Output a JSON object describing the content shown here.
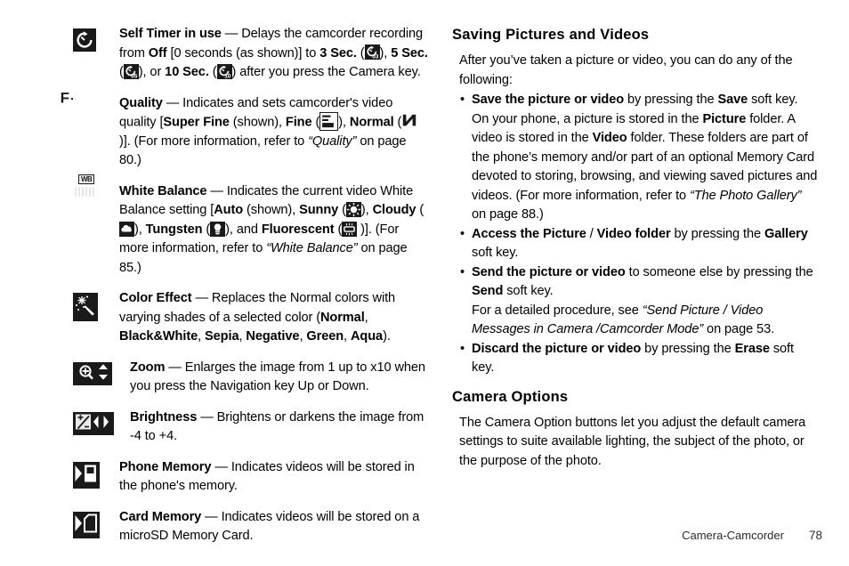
{
  "page": {
    "footer_chapter": "Camera-Camcorder",
    "footer_page_number": "78"
  },
  "left_column": {
    "items": [
      {
        "icon": "self-timer-icon",
        "term": "Self Timer in use",
        "text_parts": [
          {
            "t": " — Delays the camcorder recording from ",
            "style": "normal"
          },
          {
            "t": "Off",
            "style": "bold"
          },
          {
            "t": " [0 seconds (as shown)] to ",
            "style": "normal"
          },
          {
            "t": "3 Sec.",
            "style": "bold"
          },
          {
            "t": " (",
            "style": "normal"
          },
          {
            "t": "timer-03-icon",
            "style": "icon"
          },
          {
            "t": "), ",
            "style": "normal"
          },
          {
            "t": "5 Sec.",
            "style": "bold"
          },
          {
            "t": " (",
            "style": "normal"
          },
          {
            "t": "timer-05-icon",
            "style": "icon"
          },
          {
            "t": "), or ",
            "style": "normal"
          },
          {
            "t": "10 Sec.",
            "style": "bold"
          },
          {
            "t": " (",
            "style": "normal"
          },
          {
            "t": "timer-10-icon",
            "style": "icon"
          },
          {
            "t": ") after you press the Camera key.",
            "style": "normal"
          }
        ]
      },
      {
        "icon": "quality-super-fine-icon",
        "term": "Quality",
        "text_parts": [
          {
            "t": " — Indicates and sets camcorder's video quality [",
            "style": "normal"
          },
          {
            "t": "Super Fine",
            "style": "bold"
          },
          {
            "t": " (shown), ",
            "style": "normal"
          },
          {
            "t": "Fine",
            "style": "bold"
          },
          {
            "t": " (",
            "style": "normal"
          },
          {
            "t": "quality-fine-icon",
            "style": "icon"
          },
          {
            "t": "), ",
            "style": "normal"
          },
          {
            "t": "Normal",
            "style": "bold"
          },
          {
            "t": " (",
            "style": "normal"
          },
          {
            "t": "quality-normal-icon",
            "style": "icon"
          },
          {
            "t": " )]. (For more information, refer to ",
            "style": "normal"
          },
          {
            "t": "“Quality”",
            "style": "italic"
          },
          {
            "t": " on page 80.)",
            "style": "normal"
          }
        ]
      },
      {
        "icon": "white-balance-icon",
        "term": "White Balance",
        "text_parts": [
          {
            "t": " — Indicates the current video White Balance setting [",
            "style": "normal"
          },
          {
            "t": "Auto",
            "style": "bold"
          },
          {
            "t": " (shown), ",
            "style": "normal"
          },
          {
            "t": "Sunny",
            "style": "bold"
          },
          {
            "t": " (",
            "style": "normal"
          },
          {
            "t": "sunny-icon",
            "style": "icon"
          },
          {
            "t": "), ",
            "style": "normal"
          },
          {
            "t": "Cloudy",
            "style": "bold"
          },
          {
            "t": " (",
            "style": "normal"
          },
          {
            "t": "cloudy-icon",
            "style": "icon"
          },
          {
            "t": "), ",
            "style": "normal"
          },
          {
            "t": "Tungsten",
            "style": "bold"
          },
          {
            "t": " (",
            "style": "normal"
          },
          {
            "t": "tungsten-icon",
            "style": "icon"
          },
          {
            "t": "), and ",
            "style": "normal"
          },
          {
            "t": "Fluorescent",
            "style": "bold"
          },
          {
            "t": " (",
            "style": "normal"
          },
          {
            "t": "fluorescent-icon",
            "style": "icon"
          },
          {
            "t": " )]. (For more information, refer to ",
            "style": "normal"
          },
          {
            "t": "“White Balance”",
            "style": "italic"
          },
          {
            "t": " on page 85.)",
            "style": "normal"
          }
        ]
      },
      {
        "icon": "color-effect-icon",
        "term": "Color Effect",
        "text_parts": [
          {
            "t": " — Replaces the Normal colors with varying shades of a selected color (",
            "style": "normal"
          },
          {
            "t": "Normal",
            "style": "bold"
          },
          {
            "t": ", ",
            "style": "normal"
          },
          {
            "t": "Black&White",
            "style": "bold"
          },
          {
            "t": ", ",
            "style": "normal"
          },
          {
            "t": "Sepia",
            "style": "bold"
          },
          {
            "t": ", ",
            "style": "normal"
          },
          {
            "t": "Negative",
            "style": "bold"
          },
          {
            "t": ", ",
            "style": "normal"
          },
          {
            "t": "Green",
            "style": "bold"
          },
          {
            "t": ", ",
            "style": "normal"
          },
          {
            "t": "Aqua",
            "style": "bold"
          },
          {
            "t": ").",
            "style": "normal"
          }
        ]
      },
      {
        "icon": "zoom-icon",
        "term": "Zoom",
        "indent": true,
        "text_parts": [
          {
            "t": " — Enlarges the image from 1 up to x10 when you press the Navigation key Up or Down.",
            "style": "normal"
          }
        ]
      },
      {
        "icon": "brightness-icon",
        "term": "Brightness",
        "indent": true,
        "text_parts": [
          {
            "t": " — Brightens or darkens the image from -4 to +4.",
            "style": "normal"
          }
        ]
      },
      {
        "icon": "phone-memory-icon",
        "term": "Phone Memory",
        "text_parts": [
          {
            "t": " — Indicates videos will be stored in the phone's memory.",
            "style": "normal"
          }
        ]
      },
      {
        "icon": "card-memory-icon",
        "term": "Card Memory",
        "text_parts": [
          {
            "t": " — Indicates videos will be stored on a microSD Memory Card.",
            "style": "normal"
          }
        ]
      }
    ]
  },
  "right_column": {
    "heading_1": "Saving Pictures and Videos",
    "intro": "After you’ve taken a picture or video, you can do any of the following:",
    "bullet_1": {
      "bold_lead": "Save the picture or video",
      "mid": " by pressing the ",
      "bold_2": "Save",
      "tail": " soft key."
    },
    "bullet_1_sub": {
      "p1": "On your phone, a picture is stored in the ",
      "b1": "Picture",
      "p2": " folder. A video is stored in the ",
      "b2": "Video",
      "p3": " folder. These folders are part of the phone’s memory and/or part of an optional Memory Card devoted to storing, browsing, and viewing saved pictures and videos. (For more information, refer to ",
      "i1": "“The Photo Gallery”",
      "p4": " on page 88.)"
    },
    "bullet_2": {
      "bold_lead": "Access the Picture",
      "sep": " / ",
      "bold_2": "Video folder",
      "mid": " by pressing the ",
      "bold_3": "Gallery",
      "tail": " soft key."
    },
    "bullet_3": {
      "bold_lead": "Send the picture or video",
      "mid": " to someone else by pressing the ",
      "bold_2": "Send",
      "tail": " soft key."
    },
    "bullet_3_sub": {
      "p1": "For a detailed procedure, see ",
      "i1": "“Send Picture / Video Messages in Camera /Camcorder Mode”",
      "p2": " on page 53."
    },
    "bullet_4": {
      "bold_lead": "Discard the picture or video",
      "mid": " by pressing the ",
      "bold_2": "Erase",
      "tail": " soft key."
    },
    "heading_2": "Camera Options",
    "para_2": "The Camera Option buttons let you adjust the default camera settings to suite available lighting, the subject of the photo, or the purpose of the photo."
  },
  "colors": {
    "ink": "#000000",
    "icon_bg": "#1a1a1a",
    "icon_fg": "#ffffff"
  }
}
